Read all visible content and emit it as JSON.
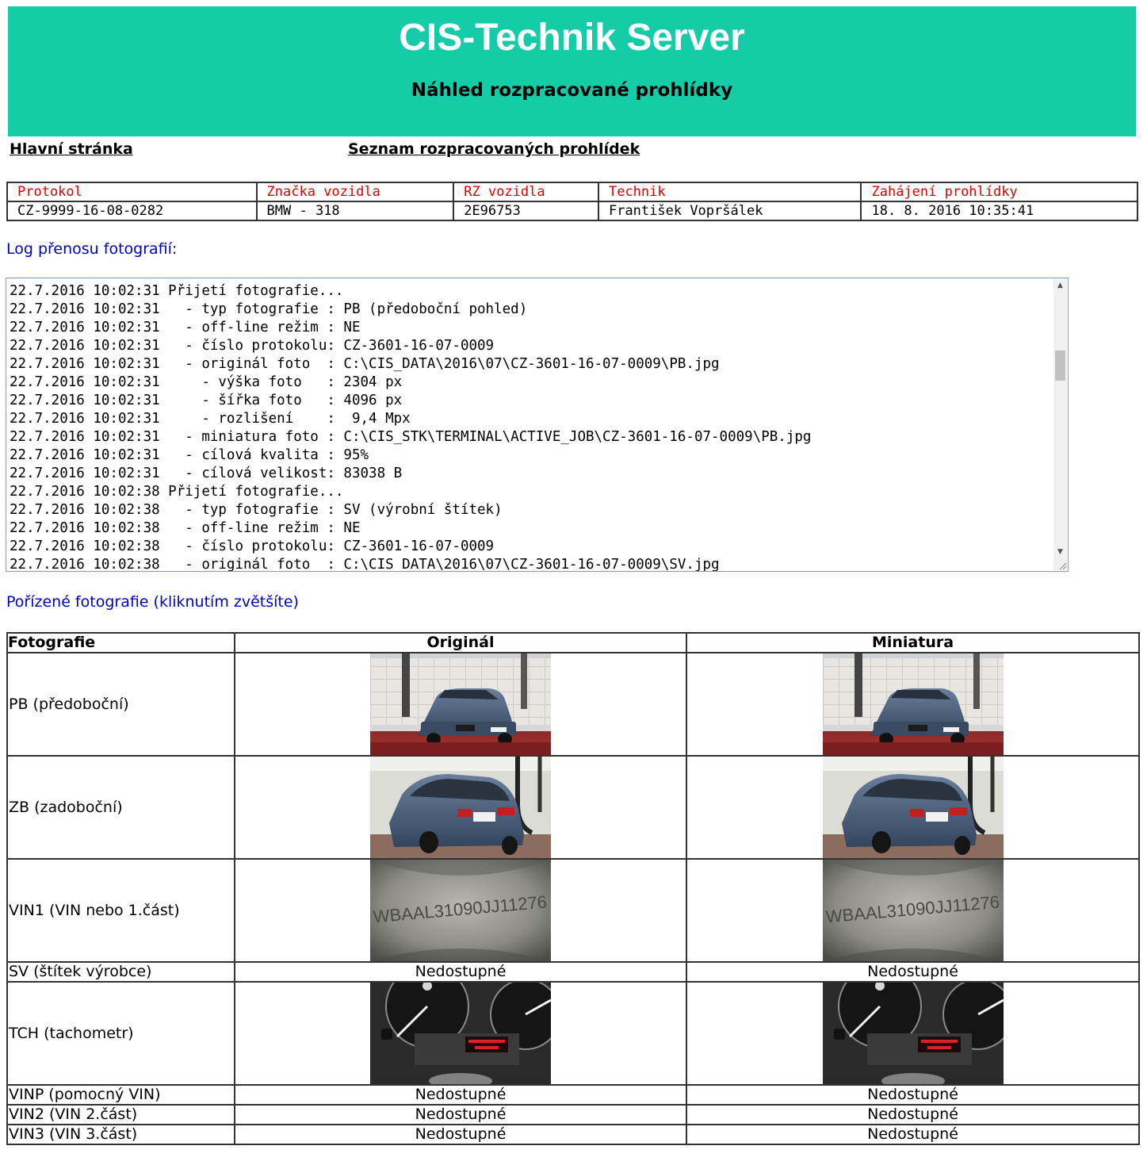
{
  "header": {
    "title": "CIS-Technik Server",
    "subtitle": "Náhled rozpracované prohlídky"
  },
  "nav": {
    "home": "Hlavní stránka",
    "list": "Seznam rozpracovaných prohlídek"
  },
  "info": {
    "headers": [
      "Protokol",
      "Značka vozidla",
      "RZ vozidla",
      "Technik",
      "Zahájení prohlídky"
    ],
    "values": [
      "CZ-9999-16-08-0282",
      "BMW - 318",
      "2E96753",
      "František Vopršálek",
      "18. 8. 2016 10:35:41"
    ]
  },
  "log": {
    "label": "Log přenosu fotografií:",
    "lines": [
      "22.7.2016 10:02:31 Přijetí fotografie...",
      "22.7.2016 10:02:31   - typ fotografie : PB (předoboční pohled)",
      "22.7.2016 10:02:31   - off-line režim : NE",
      "22.7.2016 10:02:31   - číslo protokolu: CZ-3601-16-07-0009",
      "22.7.2016 10:02:31   - originál foto  : C:\\CIS_DATA\\2016\\07\\CZ-3601-16-07-0009\\PB.jpg",
      "22.7.2016 10:02:31     - výška foto   : 2304 px",
      "22.7.2016 10:02:31     - šířka foto   : 4096 px",
      "22.7.2016 10:02:31     - rozlišení    :  9,4 Mpx",
      "22.7.2016 10:02:31   - miniatura foto : C:\\CIS_STK\\TERMINAL\\ACTIVE_JOB\\CZ-3601-16-07-0009\\PB.jpg",
      "22.7.2016 10:02:31   - cílová kvalita : 95%",
      "22.7.2016 10:02:31   - cílová velikost: 83038 B",
      "22.7.2016 10:02:38 Přijetí fotografie...",
      "22.7.2016 10:02:38   - typ fotografie : SV (výrobní štítek)",
      "22.7.2016 10:02:38   - off-line režim : NE",
      "22.7.2016 10:02:38   - číslo protokolu: CZ-3601-16-07-0009",
      "22.7.2016 10:02:38   - originál foto  : C:\\CIS_DATA\\2016\\07\\CZ-3601-16-07-0009\\SV.jpg"
    ]
  },
  "photos": {
    "label": "Pořízené fotografie (kliknutím zvětšíte)",
    "headers": [
      "Fotografie",
      "Originál",
      "Miniatura"
    ],
    "unavailable": "Nedostupné",
    "rows": [
      {
        "label": "PB (předoboční)",
        "kind": "car-front",
        "available": true
      },
      {
        "label": "ZB (zadoboční)",
        "kind": "car-rear",
        "available": true
      },
      {
        "label": "VIN1 (VIN nebo 1.část)",
        "kind": "vin",
        "available": true
      },
      {
        "label": "SV (štítek výrobce)",
        "kind": "none",
        "available": false
      },
      {
        "label": "TCH (tachometr)",
        "kind": "tacho",
        "available": true
      },
      {
        "label": "VINP (pomocný VIN)",
        "kind": "none",
        "available": false
      },
      {
        "label": "VIN2 (VIN 2.část)",
        "kind": "none",
        "available": false
      },
      {
        "label": "VIN3 (VIN 3.část)",
        "kind": "none",
        "available": false
      }
    ],
    "vin_text": "WBAAL31090JJ11276"
  }
}
